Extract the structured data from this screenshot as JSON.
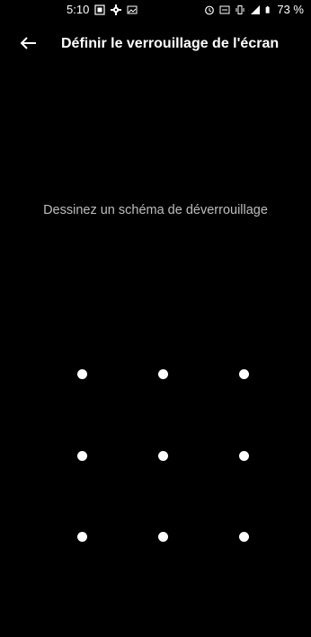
{
  "status_bar": {
    "time": "5:10",
    "battery": "73 %",
    "left_icons": [
      "screenshot-icon",
      "gear-icon",
      "image-icon"
    ],
    "right_icons": [
      "alarm-icon",
      "nfc-icon",
      "vibrate-icon",
      "signal-icon",
      "battery-icon"
    ]
  },
  "header": {
    "title": "Définir le verrouillage de l'écran"
  },
  "main": {
    "prompt": "Dessinez un schéma de déverrouillage"
  },
  "pattern": {
    "rows": 3,
    "cols": 3
  },
  "colors": {
    "background": "#000000",
    "text": "#ffffff",
    "prompt": "#bdbdbd",
    "dot": "#ffffff"
  }
}
